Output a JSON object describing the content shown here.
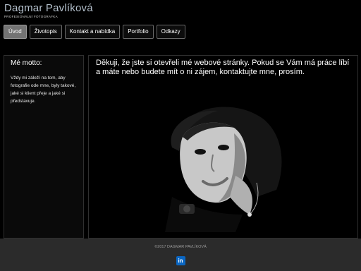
{
  "brand": {
    "title": "Dagmar Pavlíková",
    "subtitle": "PROFESIONÁLNÍ FOTOGRAFKA"
  },
  "nav": [
    {
      "label": "Úvod"
    },
    {
      "label": "Životopis"
    },
    {
      "label": "Kontakt a nabídka"
    },
    {
      "label": "Portfolio"
    },
    {
      "label": "Odkazy"
    }
  ],
  "sidebar": {
    "heading": "Mé motto:",
    "text": "Vždy mi záleží na tom, aby fotografie ode mne, byly takové, jaké si klient přeje a jaké si představuje."
  },
  "main": {
    "intro": "Děkuji, že jste si otevřeli mé webové stránky. Pokud se Vám má práce líbí a máte nebo budete mít o ni zájem, kontaktujte mne, prosím."
  },
  "footer": {
    "copyright": "©2017 DAGMAR PAVLÍKOVÁ",
    "social_icon": "linkedin-icon",
    "social_text": "in"
  },
  "colors": {
    "nav_active": "#737373",
    "footer_bg": "#2b2b2b",
    "linkedin": "#0a66c2"
  }
}
